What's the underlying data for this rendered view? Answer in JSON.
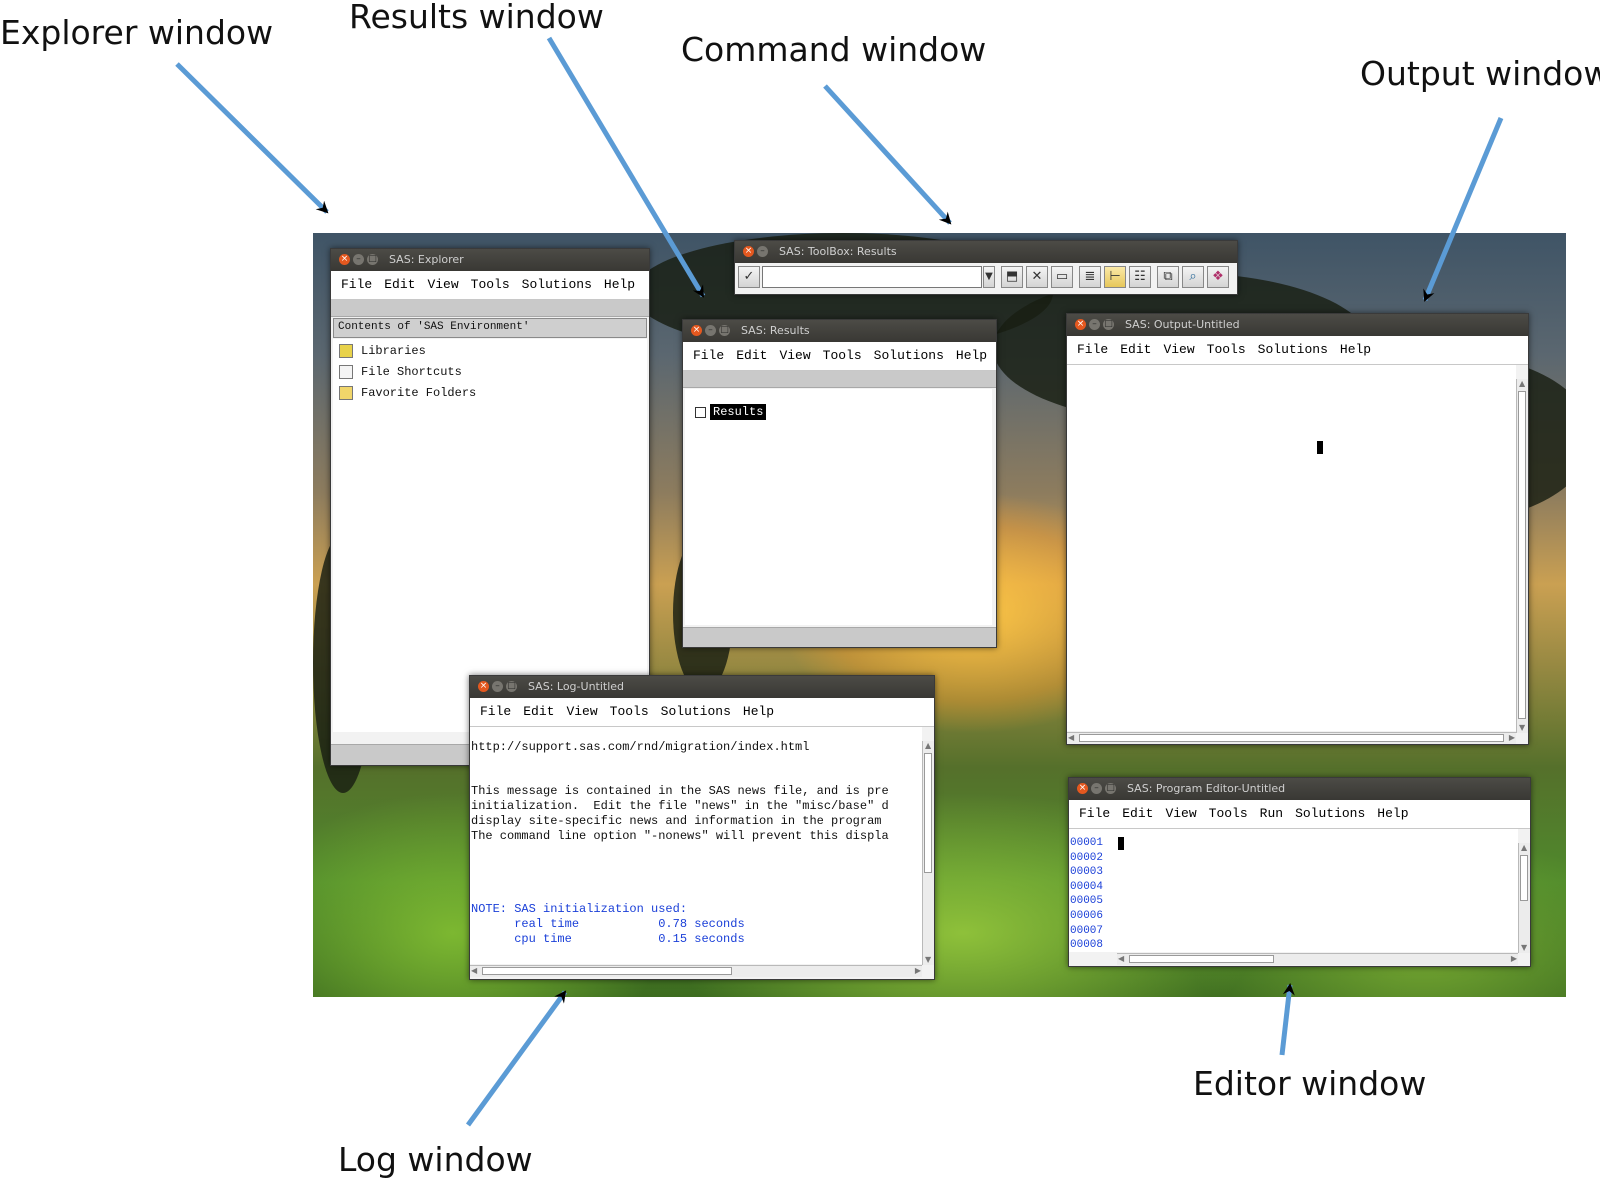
{
  "callouts": {
    "explorer": "Explorer window",
    "results": "Results window",
    "command": "Command window",
    "output": "Output window",
    "log": "Log window",
    "editor": "Editor window"
  },
  "menu_common": [
    "File",
    "Edit",
    "View",
    "Tools",
    "Solutions",
    "Help"
  ],
  "explorer": {
    "title": "SAS: Explorer",
    "header": "Contents of 'SAS Environment'",
    "items": [
      {
        "label": "Libraries",
        "icon": "library-icon"
      },
      {
        "label": "File Shortcuts",
        "icon": "file-shortcuts-icon"
      },
      {
        "label": "Favorite Folders",
        "icon": "favorite-folders-icon"
      }
    ]
  },
  "toolbox": {
    "title": "SAS: ToolBox: Results",
    "command_value": "",
    "icons": [
      "checkmark-icon",
      "dropdown-arrow-icon",
      "open-icon",
      "close-x-icon",
      "rename-icon",
      "list-view-icon",
      "tree-view-icon",
      "details-icon",
      "properties-icon",
      "find-icon",
      "help-book-icon"
    ]
  },
  "results": {
    "title": "SAS: Results",
    "root": "Results"
  },
  "output": {
    "title": "SAS: Output-Untitled"
  },
  "log": {
    "title": "SAS: Log-Untitled",
    "lines": [
      "http://support.sas.com/rnd/migration/index.html",
      "",
      "",
      "This message is contained in the SAS news file, and is pre",
      "initialization.  Edit the file \"news\" in the \"misc/base\" d",
      "display site-specific news and information in the program",
      "The command line option \"-nonews\" will prevent this displa"
    ],
    "note_lines": [
      "NOTE: SAS initialization used:",
      "      real time           0.78 seconds",
      "      cpu time            0.15 seconds"
    ]
  },
  "editor": {
    "title": "SAS: Program Editor-Untitled",
    "menu": [
      "File",
      "Edit",
      "View",
      "Tools",
      "Run",
      "Solutions",
      "Help"
    ],
    "line_numbers": [
      "00001",
      "00002",
      "00003",
      "00004",
      "00005",
      "00006",
      "00007",
      "00008"
    ]
  },
  "colors": {
    "arrow": "#5b9bd5",
    "titlebar": "#3f3e3a",
    "close_button": "#e4581f",
    "note_blue": "#1a3fd8"
  }
}
